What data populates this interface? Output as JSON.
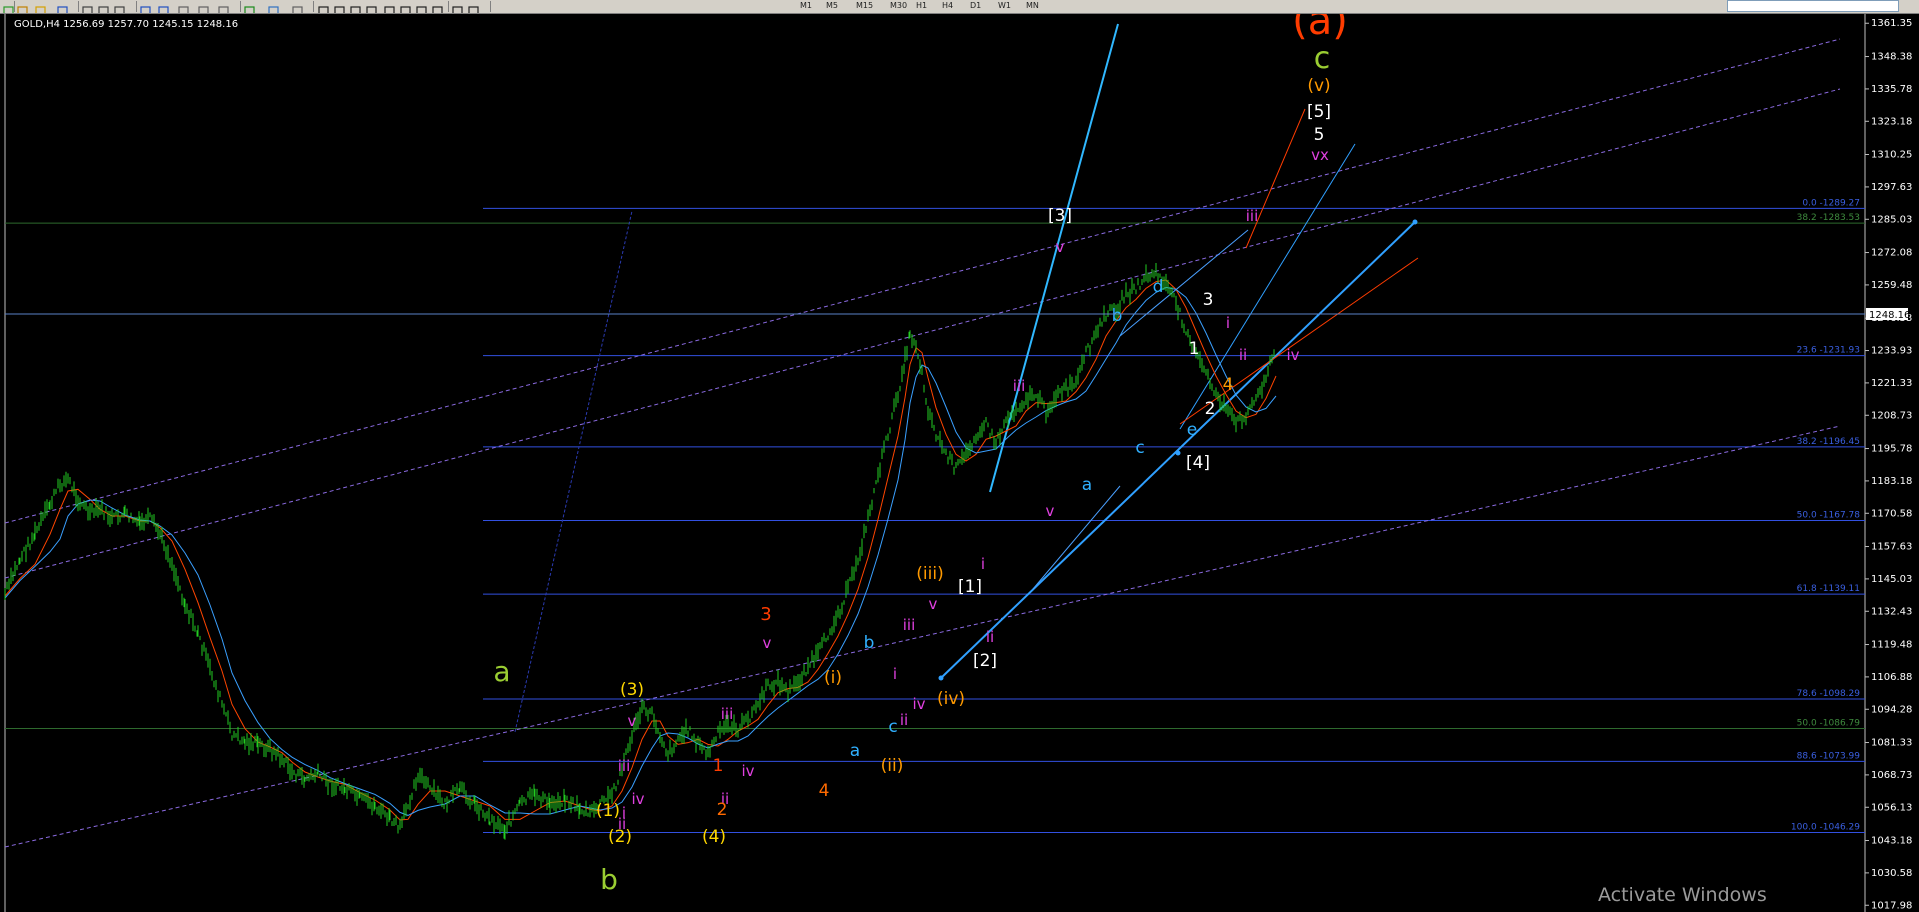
{
  "toolbar": {
    "timeframes": [
      "M1",
      "M5",
      "M15",
      "M30",
      "H1",
      "H4",
      "D1",
      "W1",
      "MN"
    ],
    "icons": [
      "new-chart-icon",
      "profiles-icon",
      "favorites-icon",
      "save-icon",
      "line-chart-icon",
      "bar-chart-icon",
      "candles-icon",
      "zoom-in-icon",
      "zoom-out-icon",
      "tile-icon",
      "autoscroll-icon",
      "chart-shift-icon",
      "indicators-icon",
      "periods-icon",
      "templates-icon",
      "cursor-icon",
      "crosshair-icon",
      "vertical-line-icon",
      "horizontal-line-icon",
      "trendline-icon",
      "equidistant-channel-icon",
      "fibonacci-icon",
      "text-icon",
      "label-icon",
      "arrows-icon"
    ]
  },
  "chart_data": {
    "type": "line",
    "symbol_header": "GOLD,H4  1256.69 1257.70 1245.15 1248.16",
    "price_tag": "1248.16",
    "y_axis": {
      "min": 1017.3,
      "max": 1363.0,
      "ticks": [
        "1361.35",
        "1348.38",
        "1335.78",
        "1323.18",
        "1310.25",
        "1297.63",
        "1285.03",
        "1272.08",
        "1259.48",
        "1246.53",
        "1233.93",
        "1221.33",
        "1208.73",
        "1195.78",
        "1183.18",
        "1170.58",
        "1157.63",
        "1145.03",
        "1132.43",
        "1119.48",
        "1106.88",
        "1094.28",
        "1081.33",
        "1068.73",
        "1056.13",
        "1043.18",
        "1030.58",
        "1017.98"
      ]
    },
    "fibonacci_levels": [
      {
        "label": "0.0 -1289.27",
        "price": 1289.27,
        "color": "#3250e0"
      },
      {
        "label": "38.2 -1283.53",
        "price": 1283.53,
        "color": "#2e6a2e"
      },
      {
        "label": "23.6 -1231.93",
        "price": 1231.93,
        "color": "#3250e0"
      },
      {
        "label": "38.2 -1196.45",
        "price": 1196.45,
        "color": "#3250e0"
      },
      {
        "label": "50.0 -1167.78",
        "price": 1167.78,
        "color": "#3250e0"
      },
      {
        "label": "61.8 -1139.11",
        "price": 1139.11,
        "color": "#3250e0"
      },
      {
        "label": "78.6 -1098.29",
        "price": 1098.29,
        "color": "#3250e0"
      },
      {
        "label": "50.0 -1086.79",
        "price": 1086.79,
        "color": "#2e6a2e"
      },
      {
        "label": "88.6 -1073.99",
        "price": 1073.99,
        "color": "#3250e0"
      },
      {
        "label": "100.0 -1046.29",
        "price": 1046.29,
        "color": "#3250e0"
      }
    ],
    "current_price": 1248.16,
    "price_path": [
      [
        5,
        580
      ],
      [
        20,
        545
      ],
      [
        35,
        520
      ],
      [
        50,
        490
      ],
      [
        60,
        470
      ],
      [
        68,
        465
      ],
      [
        78,
        485
      ],
      [
        90,
        500
      ],
      [
        100,
        495
      ],
      [
        112,
        505
      ],
      [
        125,
        500
      ],
      [
        140,
        510
      ],
      [
        150,
        505
      ],
      [
        160,
        520
      ],
      [
        172,
        550
      ],
      [
        185,
        590
      ],
      [
        198,
        620
      ],
      [
        210,
        655
      ],
      [
        222,
        690
      ],
      [
        232,
        720
      ],
      [
        245,
        728
      ],
      [
        258,
        730
      ],
      [
        270,
        735
      ],
      [
        282,
        745
      ],
      [
        292,
        758
      ],
      [
        305,
        765
      ],
      [
        318,
        760
      ],
      [
        330,
        770
      ],
      [
        345,
        775
      ],
      [
        360,
        785
      ],
      [
        375,
        792
      ],
      [
        390,
        805
      ],
      [
        400,
        815
      ],
      [
        408,
        790
      ],
      [
        418,
        760
      ],
      [
        430,
        775
      ],
      [
        445,
        790
      ],
      [
        460,
        775
      ],
      [
        475,
        790
      ],
      [
        490,
        805
      ],
      [
        505,
        815
      ],
      [
        520,
        790
      ],
      [
        535,
        780
      ],
      [
        550,
        790
      ],
      [
        565,
        785
      ],
      [
        580,
        795
      ],
      [
        590,
        800
      ],
      [
        600,
        790
      ],
      [
        612,
        780
      ],
      [
        622,
        755
      ],
      [
        632,
        720
      ],
      [
        642,
        695
      ],
      [
        652,
        700
      ],
      [
        660,
        720
      ],
      [
        668,
        740
      ],
      [
        678,
        725
      ],
      [
        688,
        715
      ],
      [
        698,
        730
      ],
      [
        708,
        740
      ],
      [
        718,
        720
      ],
      [
        728,
        710
      ],
      [
        738,
        715
      ],
      [
        748,
        705
      ],
      [
        758,
        690
      ],
      [
        768,
        672
      ],
      [
        778,
        668
      ],
      [
        788,
        678
      ],
      [
        798,
        668
      ],
      [
        808,
        652
      ],
      [
        818,
        640
      ],
      [
        828,
        620
      ],
      [
        838,
        600
      ],
      [
        848,
        575
      ],
      [
        858,
        545
      ],
      [
        868,
        505
      ],
      [
        878,
        460
      ],
      [
        888,
        420
      ],
      [
        898,
        380
      ],
      [
        905,
        345
      ],
      [
        910,
        320
      ],
      [
        916,
        330
      ],
      [
        922,
        360
      ],
      [
        928,
        395
      ],
      [
        936,
        420
      ],
      [
        946,
        440
      ],
      [
        956,
        455
      ],
      [
        966,
        440
      ],
      [
        976,
        420
      ],
      [
        986,
        410
      ],
      [
        996,
        430
      ],
      [
        1006,
        405
      ],
      [
        1016,
        395
      ],
      [
        1026,
        385
      ],
      [
        1036,
        380
      ],
      [
        1046,
        398
      ],
      [
        1056,
        382
      ],
      [
        1066,
        375
      ],
      [
        1076,
        370
      ],
      [
        1086,
        340
      ],
      [
        1096,
        320
      ],
      [
        1106,
        300
      ],
      [
        1116,
        295
      ],
      [
        1126,
        280
      ],
      [
        1136,
        275
      ],
      [
        1146,
        262
      ],
      [
        1156,
        260
      ],
      [
        1166,
        270
      ],
      [
        1176,
        290
      ],
      [
        1186,
        315
      ],
      [
        1196,
        340
      ],
      [
        1206,
        360
      ],
      [
        1216,
        380
      ],
      [
        1226,
        395
      ],
      [
        1236,
        410
      ],
      [
        1246,
        400
      ],
      [
        1256,
        385
      ],
      [
        1266,
        362
      ],
      [
        1276,
        333
      ]
    ],
    "wave_labels": [
      {
        "text": "(a)",
        "color": "#ff3c00",
        "size": "40"
      },
      {
        "text": "c",
        "color": "#9acd32",
        "size": "30"
      },
      {
        "text": "(v)",
        "color": "#ff9a00",
        "size": "17"
      },
      {
        "text": "[5]",
        "color": "#ffffff",
        "size": "17"
      },
      {
        "text": "5",
        "color": "#ffffff",
        "size": "17"
      },
      {
        "text": "vx",
        "color": "#e040e0",
        "size": "15"
      },
      {
        "text": "iii",
        "color": "#e040e0",
        "size": "15"
      },
      {
        "text": "[3]",
        "color": "#ffffff",
        "size": "17"
      },
      {
        "text": "v",
        "color": "#e040e0",
        "size": "15"
      },
      {
        "text": "d",
        "color": "#30b0ff",
        "size": "17"
      },
      {
        "text": "b",
        "color": "#30b0ff",
        "size": "17"
      },
      {
        "text": "3",
        "color": "#ffffff",
        "size": "17"
      },
      {
        "text": "i",
        "color": "#e040e0",
        "size": "15"
      },
      {
        "text": "1",
        "color": "#ffffff",
        "size": "17"
      },
      {
        "text": "ii",
        "color": "#e040e0",
        "size": "15"
      },
      {
        "text": "iv",
        "color": "#e040e0",
        "size": "15"
      },
      {
        "text": "4",
        "color": "#ff9a00",
        "size": "17"
      },
      {
        "text": "iii",
        "color": "#e040e0",
        "size": "15"
      },
      {
        "text": "2",
        "color": "#ffffff",
        "size": "17"
      },
      {
        "text": "e",
        "color": "#30b0ff",
        "size": "17"
      },
      {
        "text": "c",
        "color": "#30b0ff",
        "size": "17"
      },
      {
        "text": "[4]",
        "color": "#ffffff",
        "size": "17"
      },
      {
        "text": "a",
        "color": "#30b0ff",
        "size": "17"
      },
      {
        "text": "v",
        "color": "#e040e0",
        "size": "15"
      },
      {
        "text": "(iii)",
        "color": "#ff9a00",
        "size": "17"
      },
      {
        "text": "i",
        "color": "#e040e0",
        "size": "15"
      },
      {
        "text": "[1]",
        "color": "#ffffff",
        "size": "17"
      },
      {
        "text": "v",
        "color": "#e040e0",
        "size": "15"
      },
      {
        "text": "iii",
        "color": "#e040e0",
        "size": "15"
      },
      {
        "text": "ii",
        "color": "#e040e0",
        "size": "15"
      },
      {
        "text": "[2]",
        "color": "#ffffff",
        "size": "17"
      },
      {
        "text": "b",
        "color": "#30b0ff",
        "size": "17"
      },
      {
        "text": "(i)",
        "color": "#ff9a00",
        "size": "17"
      },
      {
        "text": "i",
        "color": "#e040e0",
        "size": "15"
      },
      {
        "text": "iv",
        "color": "#e040e0",
        "size": "15"
      },
      {
        "text": "(iv)",
        "color": "#ff9a00",
        "size": "17"
      },
      {
        "text": "c",
        "color": "#30b0ff",
        "size": "17"
      },
      {
        "text": "ii",
        "color": "#e040e0",
        "size": "15"
      },
      {
        "text": "a",
        "color": "#30b0ff",
        "size": "17"
      },
      {
        "text": "(ii)",
        "color": "#ff9a00",
        "size": "17"
      },
      {
        "text": "3",
        "color": "#ff3c00",
        "size": "18"
      },
      {
        "text": "v",
        "color": "#e040e0",
        "size": "15"
      },
      {
        "text": "iii",
        "color": "#e040e0",
        "size": "15"
      },
      {
        "text": "1",
        "color": "#ff3c00",
        "size": "17"
      },
      {
        "text": "iv",
        "color": "#e040e0",
        "size": "15"
      },
      {
        "text": "ii",
        "color": "#e040e0",
        "size": "15"
      },
      {
        "text": "2",
        "color": "#ff6a00",
        "size": "17"
      },
      {
        "text": "4",
        "color": "#ff6a00",
        "size": "17"
      },
      {
        "text": "a",
        "color": "#9acd32",
        "size": "28"
      },
      {
        "text": "(3)",
        "color": "#ffd700",
        "size": "17"
      },
      {
        "text": "v",
        "color": "#e040e0",
        "size": "15"
      },
      {
        "text": "iii",
        "color": "#e040e0",
        "size": "15"
      },
      {
        "text": "iv",
        "color": "#e040e0",
        "size": "15"
      },
      {
        "text": "(1)",
        "color": "#ffd700",
        "size": "17"
      },
      {
        "text": "i",
        "color": "#e040e0",
        "size": "15"
      },
      {
        "text": "ii",
        "color": "#e040e0",
        "size": "15"
      },
      {
        "text": "(2)",
        "color": "#ffd700",
        "size": "17"
      },
      {
        "text": "(4)",
        "color": "#ffd700",
        "size": "17"
      },
      {
        "text": "b",
        "color": "#9acd32",
        "size": "28"
      }
    ]
  },
  "watermark": "Activate Windows"
}
